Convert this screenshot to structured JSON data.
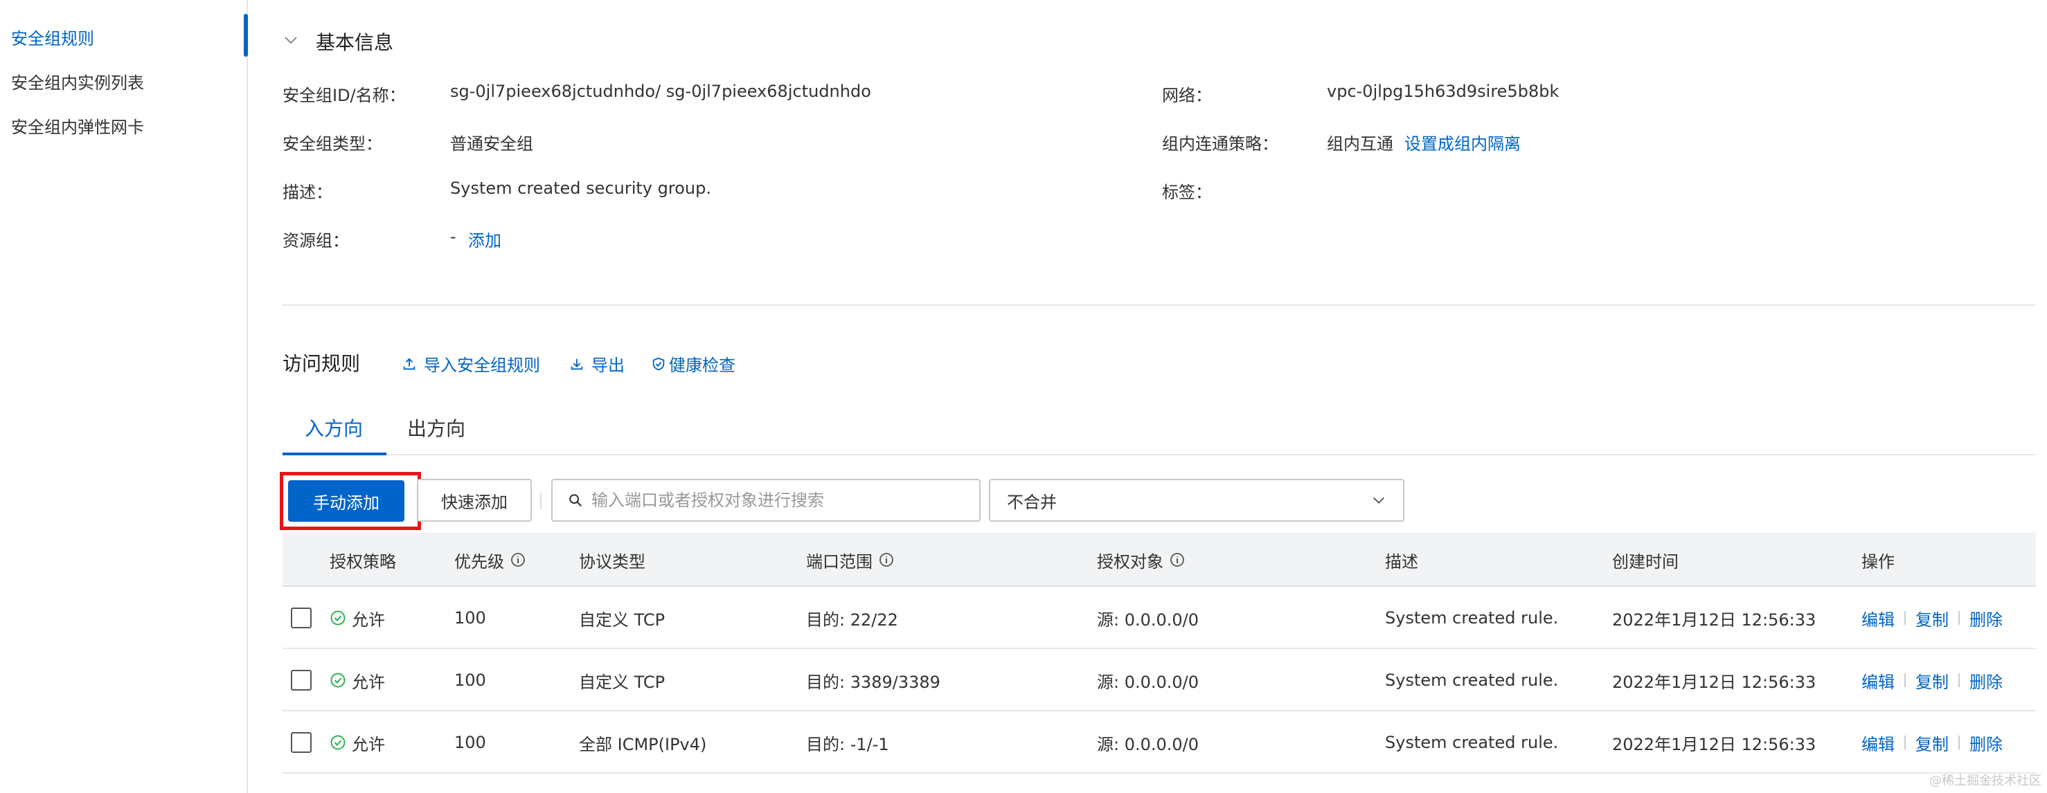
{
  "sidebar": {
    "items": [
      {
        "label": "安全组规则"
      },
      {
        "label": "安全组内实例列表"
      },
      {
        "label": "安全组内弹性网卡"
      }
    ]
  },
  "basic_info": {
    "title": "基本信息",
    "fields": {
      "id_name": {
        "label": "安全组ID/名称：",
        "value": "sg-0jl7pieex68jctudnhdo/ sg-0jl7pieex68jctudnhdo"
      },
      "type": {
        "label": "安全组类型：",
        "value": "普通安全组"
      },
      "description": {
        "label": "描述：",
        "value": "System created security group."
      },
      "resource_group": {
        "label": "资源组：",
        "value": "-",
        "link": "添加"
      },
      "network": {
        "label": "网络：",
        "value": "vpc-0jlpg15h63d9sire5b8bk"
      },
      "intra_policy": {
        "label": "组内连通策略：",
        "value": "组内互通",
        "link": "设置成组内隔离"
      },
      "tags": {
        "label": "标签："
      }
    }
  },
  "access_rules": {
    "title": "访问规则",
    "actions": {
      "import": "导入安全组规则",
      "export": "导出",
      "health_check": "健康检查"
    },
    "tabs": [
      {
        "label": "入方向"
      },
      {
        "label": "出方向"
      }
    ],
    "toolbar": {
      "manual_add": "手动添加",
      "quick_add": "快速添加",
      "search_placeholder": "输入端口或者授权对象进行搜索",
      "merge_select": "不合并"
    },
    "table": {
      "headers": {
        "policy": "授权策略",
        "priority": "优先级",
        "protocol": "协议类型",
        "port_range": "端口范围",
        "target": "授权对象",
        "description": "描述",
        "created": "创建时间",
        "actions": "操作"
      },
      "rows": [
        {
          "policy": "允许",
          "priority": "100",
          "protocol": "自定义 TCP",
          "port": "目的: 22/22",
          "target": "源: 0.0.0.0/0",
          "description": "System created rule.",
          "created": "2022年1月12日 12:56:33"
        },
        {
          "policy": "允许",
          "priority": "100",
          "protocol": "自定义 TCP",
          "port": "目的: 3389/3389",
          "target": "源: 0.0.0.0/0",
          "description": "System created rule.",
          "created": "2022年1月12日 12:56:33"
        },
        {
          "policy": "允许",
          "priority": "100",
          "protocol": "全部 ICMP(IPv4)",
          "port": "目的: -1/-1",
          "target": "源: 0.0.0.0/0",
          "description": "System created rule.",
          "created": "2022年1月12日 12:56:33"
        }
      ],
      "row_actions": {
        "edit": "编辑",
        "copy": "复制",
        "delete": "删除"
      }
    }
  },
  "watermark": "@稀土掘金技术社区",
  "colors": {
    "accent": "#0064c8",
    "highlight": "#e8141b",
    "success": "#2bb352"
  }
}
